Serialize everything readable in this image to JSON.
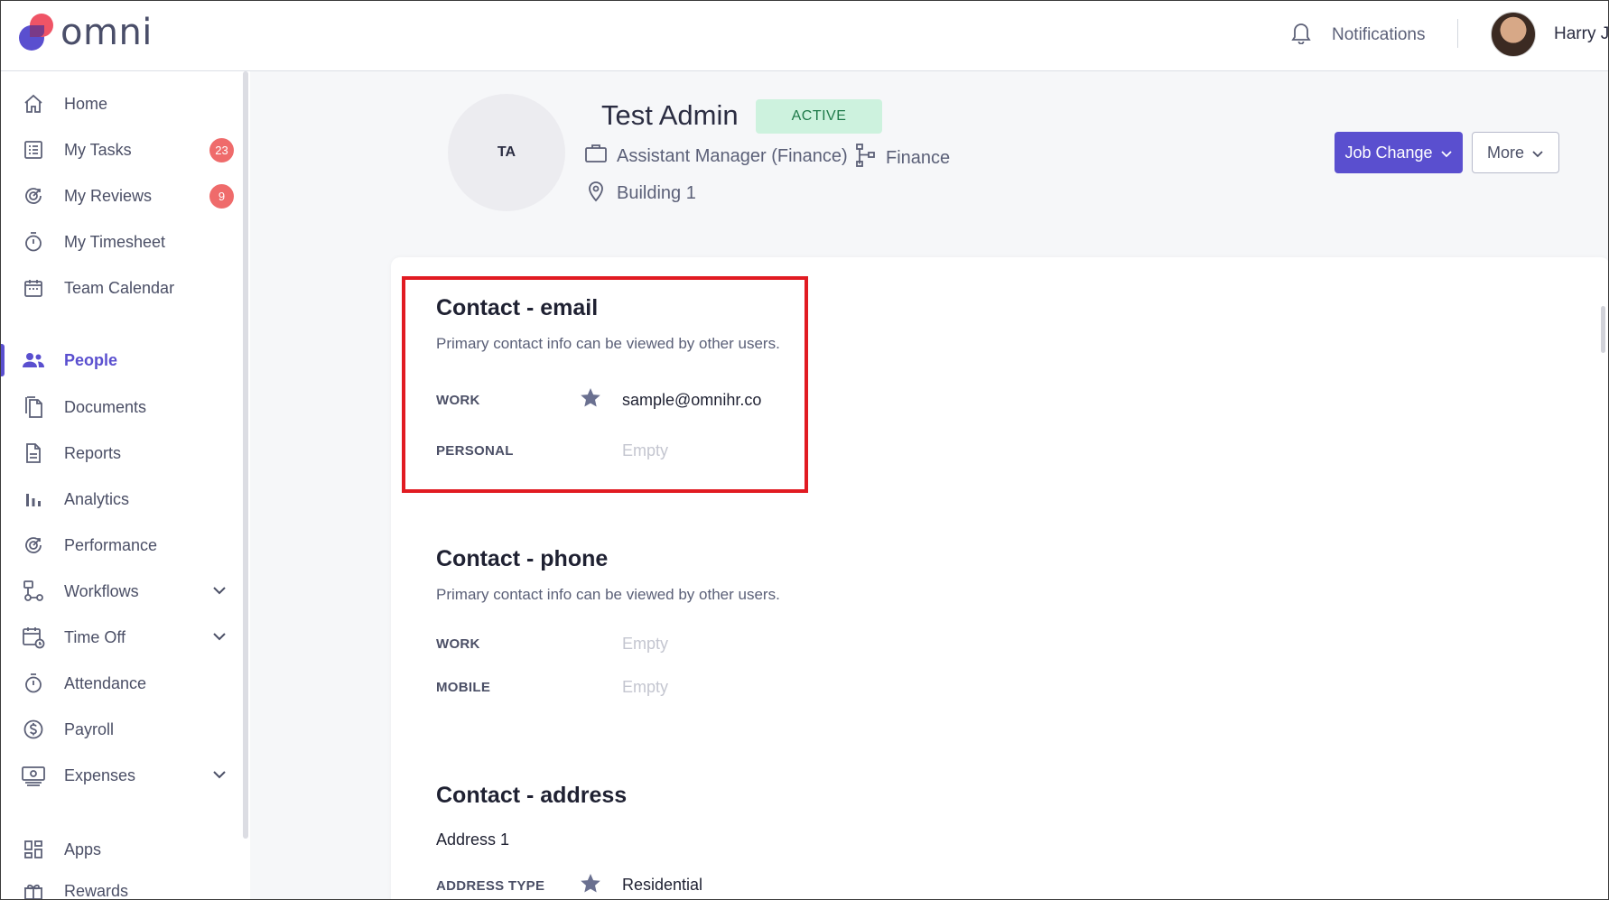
{
  "app": {
    "brand": "omni"
  },
  "header": {
    "notifications_label": "Notifications",
    "user_name": "Harry Jo"
  },
  "sidebar": {
    "items": [
      {
        "label": "Home",
        "icon": "home-icon"
      },
      {
        "label": "My Tasks",
        "icon": "tasks-icon",
        "badge": "23"
      },
      {
        "label": "My Reviews",
        "icon": "reviews-icon",
        "badge": "9"
      },
      {
        "label": "My Timesheet",
        "icon": "stopwatch-icon"
      },
      {
        "label": "Team Calendar",
        "icon": "calendar-icon"
      },
      {
        "label": "People",
        "icon": "people-icon",
        "active": true
      },
      {
        "label": "Documents",
        "icon": "documents-icon"
      },
      {
        "label": "Reports",
        "icon": "reports-icon"
      },
      {
        "label": "Analytics",
        "icon": "analytics-icon"
      },
      {
        "label": "Performance",
        "icon": "performance-icon"
      },
      {
        "label": "Workflows",
        "icon": "workflows-icon",
        "expandable": true
      },
      {
        "label": "Time Off",
        "icon": "time-off-icon",
        "expandable": true
      },
      {
        "label": "Attendance",
        "icon": "attendance-icon"
      },
      {
        "label": "Payroll",
        "icon": "payroll-icon"
      },
      {
        "label": "Expenses",
        "icon": "expenses-icon",
        "expandable": true
      },
      {
        "label": "Apps",
        "icon": "apps-icon"
      },
      {
        "label": "Rewards",
        "icon": "rewards-icon"
      }
    ]
  },
  "profile": {
    "initials": "TA",
    "name": "Test Admin",
    "status": "ACTIVE",
    "job_title": "Assistant Manager (Finance)",
    "department": "Finance",
    "location": "Building 1",
    "job_change_label": "Job Change",
    "more_label": "More"
  },
  "contact_email": {
    "title": "Contact - email",
    "description": "Primary contact info can be viewed by other users.",
    "work_label": "WORK",
    "work_value": "sample@omnihr.co",
    "personal_label": "PERSONAL",
    "personal_value": "Empty"
  },
  "contact_phone": {
    "title": "Contact - phone",
    "description": "Primary contact info can be viewed by other users.",
    "work_label": "WORK",
    "work_value": "Empty",
    "mobile_label": "MOBILE",
    "mobile_value": "Empty"
  },
  "contact_address": {
    "title": "Contact - address",
    "address_name": "Address 1",
    "address_type_label": "ADDRESS TYPE",
    "address_type_value": "Residential"
  },
  "colors": {
    "accent": "#5a4fcf",
    "badge": "#ef6b6b",
    "status_bg": "#cdf2de",
    "status_text": "#1f7a4a",
    "highlight": "#e11b22"
  }
}
